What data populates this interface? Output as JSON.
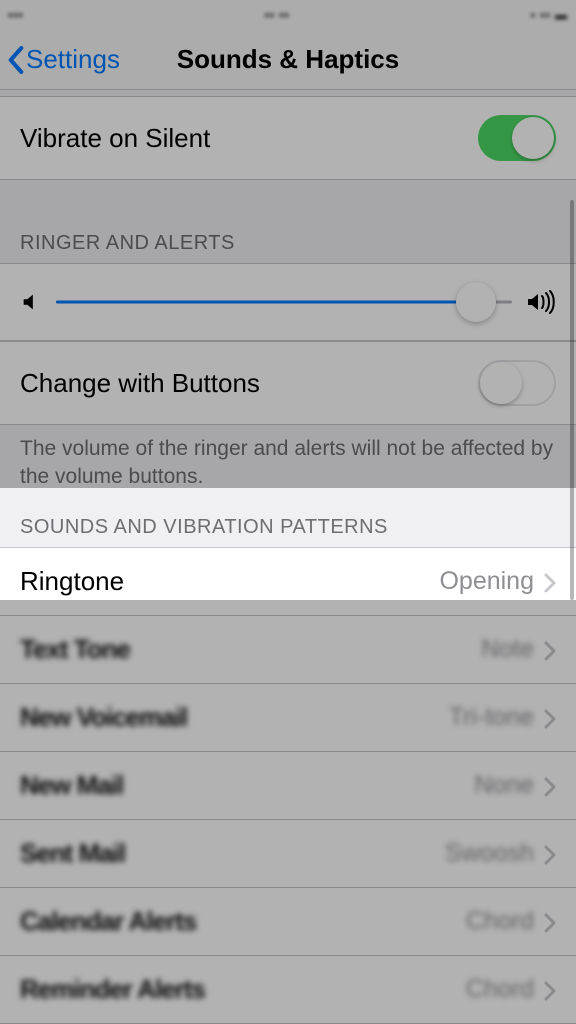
{
  "statusbar": {
    "left": "•••",
    "center": "••  ••",
    "right": "•  ••  ▬"
  },
  "nav": {
    "back": "Settings",
    "title": "Sounds & Haptics"
  },
  "vibrate_silent": {
    "label": "Vibrate on Silent",
    "on": true
  },
  "ringer": {
    "header": "RINGER AND ALERTS",
    "slider_value": 0.92,
    "change_buttons_label": "Change with Buttons",
    "change_buttons_on": false,
    "footer": "The volume of the ringer and alerts will not be affected by the volume buttons."
  },
  "patterns": {
    "header": "SOUNDS AND VIBRATION PATTERNS",
    "items": [
      {
        "label": "Ringtone",
        "value": "Opening",
        "obscured": false
      },
      {
        "label": "Text Tone",
        "value": "Note",
        "obscured": true
      },
      {
        "label": "New Voicemail",
        "value": "Tri-tone",
        "obscured": true
      },
      {
        "label": "New Mail",
        "value": "None",
        "obscured": true
      },
      {
        "label": "Sent Mail",
        "value": "Swoosh",
        "obscured": true
      },
      {
        "label": "Calendar Alerts",
        "value": "Chord",
        "obscured": true
      },
      {
        "label": "Reminder Alerts",
        "value": "Chord",
        "obscured": true
      }
    ]
  },
  "colors": {
    "tint": "#007aff",
    "switch_on": "#4cd964",
    "secondary": "#8e8e93"
  }
}
